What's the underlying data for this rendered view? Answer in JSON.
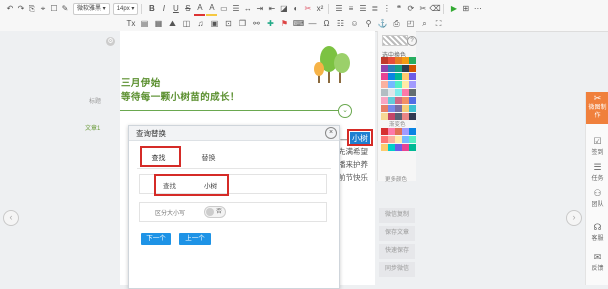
{
  "toolbar": {
    "row1": [
      "↶",
      "↷",
      "⎘",
      "⌖",
      "☐"
    ],
    "font_family": "微软雅黑",
    "font_size": "14px",
    "row1_icons": [
      "B",
      "I",
      "U",
      "A",
      "A",
      "≡",
      "≡",
      "≡",
      "≡",
      "≡",
      "Ω",
      "⋯",
      "x²",
      "x₂",
      "☰",
      "≣",
      "¶",
      "‖",
      "⊣",
      "⊢",
      "⟲",
      "⚙",
      "?"
    ],
    "row2": [
      "Tx",
      "⊟",
      "▤",
      "▦",
      "⊞",
      "◫",
      "♫",
      "⊠",
      "⊡",
      "❒",
      "◈",
      "≡",
      "≡",
      "≡",
      "☺",
      "⊕",
      "⊙",
      "⊚",
      "≡",
      "▣",
      "⊗",
      "⊘",
      "⌂"
    ]
  },
  "editor": {
    "gutter_label_1": "标题",
    "gutter_label_2": "文章1",
    "title_line_1": "三月伊始",
    "title_line_2": "等待每一颗小树苗的成长！",
    "side_text": [
      "先满希望",
      "播来护养",
      "前节快乐"
    ],
    "highlight_prefix": "一",
    "highlight_word": "小树"
  },
  "dialog": {
    "title": "查询替换",
    "tab_find": "查找",
    "tab_replace": "替换",
    "find_label": "查找",
    "find_value": "小树",
    "case_label": "区分大小写",
    "case_toggle": "否",
    "next_button": "下一个",
    "prev_button": "上一个"
  },
  "palette": {
    "header": "选中换色",
    "sub1": "渐变色",
    "sub2": "更多颜色",
    "colors": [
      [
        "#c0392b",
        "#e74c3c",
        "#e67e22",
        "#f39c12",
        "#27ae60"
      ],
      [
        "#8e44ad",
        "#2980b9",
        "#16a085",
        "#2c3e50",
        "#d35400"
      ],
      [
        "#e84393",
        "#0984e3",
        "#00b894",
        "#fdcb6e",
        "#6c5ce7"
      ],
      [
        "#fab1a0",
        "#74b9ff",
        "#55efc4",
        "#ffeaa7",
        "#a29bfe"
      ],
      [
        "#b2bec3",
        "#dfe6e9",
        "#81ecec",
        "#fd79a8",
        "#636e72"
      ],
      [
        "#f8a5c2",
        "#63cdda",
        "#cf6a87",
        "#f19066",
        "#546de5"
      ],
      [
        "#e77f67",
        "#778beb",
        "#786fa6",
        "#f5cd79",
        "#3dc1d3"
      ],
      [
        "#f7d794",
        "#c44569",
        "#596275",
        "#ea8685",
        "#303952"
      ]
    ],
    "gradient_colors": [
      [
        "#d63031",
        "#fd79a8",
        "#e17055",
        "#a29bfe",
        "#0984e3"
      ],
      [
        "#ff7675",
        "#fab1a0",
        "#ffeaa7",
        "#74b9ff",
        "#55efc4"
      ],
      [
        "#fdcb6e",
        "#00cec9",
        "#6c5ce7",
        "#e84393",
        "#00b894"
      ]
    ]
  },
  "right_buttons": [
    "微信复制",
    "保存文章",
    "快速保存",
    "同步微信"
  ],
  "right_sidebar": {
    "active": "微图制作",
    "items": [
      "签到",
      "任务",
      "团队",
      "客服",
      "反馈"
    ]
  }
}
